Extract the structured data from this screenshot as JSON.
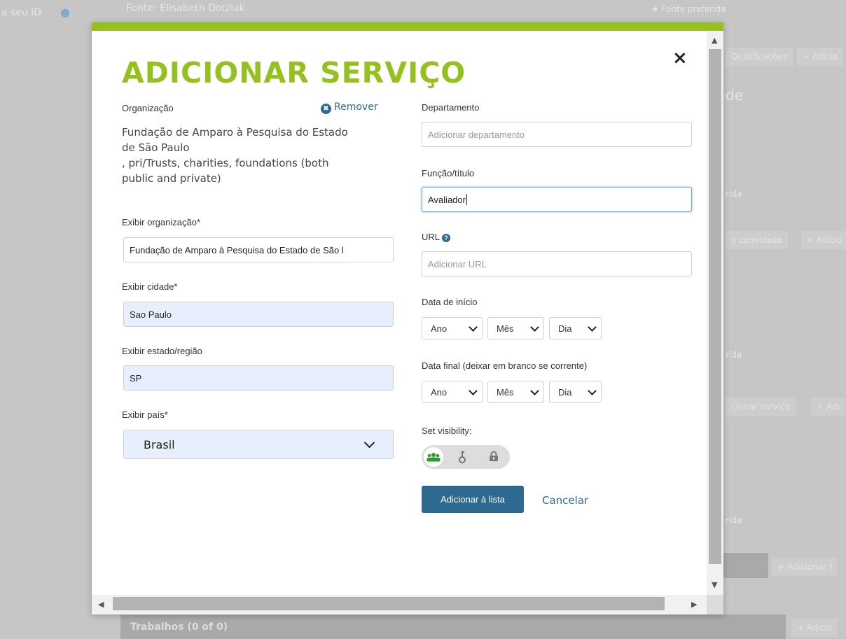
{
  "background": {
    "left_text": "a seu iD",
    "top_source": "Fonte: Elisabeth Dotziak",
    "top_preferred": "★ Fonte preferida",
    "qualifications_btn": "Qualificações",
    "add_btn_1": "+ Adicio",
    "section_partial": "de",
    "preferred_2": "rida",
    "invited_btn": "o convidada",
    "add_btn_2": "+ Adicio",
    "preferred_3": "rida",
    "add_service_btn": "cionar serviço",
    "add_btn_3": "+ Adi",
    "preferred_4": "rida",
    "add_btn_4": "+ Adicionar f",
    "works_section": "Trabalhos (0 of 0)",
    "add_btn_5": "+ Adicio"
  },
  "modal": {
    "title": "ADICIONAR SERVIÇO",
    "close_label": "×",
    "organization": {
      "label": "Organização",
      "remove_label": "Remover",
      "name_line1": "Fundação de Amparo à Pesquisa do Estado",
      "name_line2": "de São Paulo",
      "type_line1": ", pri/Trusts, charities, foundations (both",
      "type_line2": "public and private)"
    },
    "display_org": {
      "label": "Exibir organização*",
      "value": "Fundação de Amparo à Pesquisa do Estado de São l"
    },
    "display_city": {
      "label": "Exibir cidade*",
      "value": "Sao Paulo"
    },
    "display_region": {
      "label": "Exibir estado/região",
      "value": "SP"
    },
    "display_country": {
      "label": "Exibir país*",
      "value": "Brasil"
    },
    "department": {
      "label": "Departamento",
      "placeholder": "Adicionar departamento"
    },
    "role": {
      "label": "Função/título",
      "value": "Avaliador"
    },
    "url": {
      "label": "URL",
      "placeholder": "Adicionar URL"
    },
    "start_date": {
      "label": "Data de início",
      "year": "Ano",
      "month": "Mês",
      "day": "Dia"
    },
    "end_date": {
      "label": "Data final (deixar em branco se corrente)",
      "year": "Ano",
      "month": "Mês",
      "day": "Dia"
    },
    "visibility": {
      "label": "Set visibility:",
      "selected": "everyone"
    },
    "add_button": "Adicionar à lista",
    "cancel_link": "Cancelar"
  },
  "colors": {
    "accent_green": "#94c11f",
    "primary_blue": "#2e6a8f",
    "public_green": "#2a9a2a"
  },
  "icons": [
    "close-icon",
    "remove-icon",
    "help-icon",
    "chevron-down-icon",
    "everyone-icon",
    "trusted-icon",
    "private-lock-icon"
  ]
}
